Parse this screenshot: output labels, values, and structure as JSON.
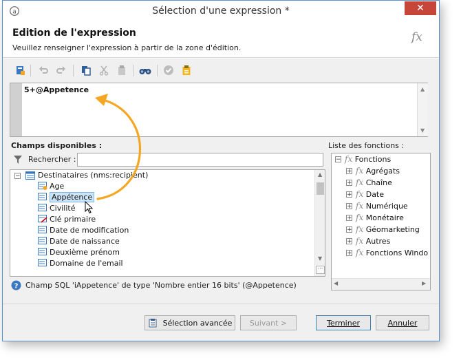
{
  "window": {
    "title": "Sélection d'une expression *",
    "close_glyph": "✕"
  },
  "header": {
    "title": "Edition de l'expression",
    "subtitle": "Veuillez renseigner l'expression à partir de la zone d'édition."
  },
  "editor": {
    "expression": "5+@Appetence"
  },
  "fields_panel": {
    "label": "Champs disponibles :",
    "search_label": "Rechercher :",
    "search_value": "",
    "root": "Destinataires (nms:recipient)",
    "items": [
      {
        "label": "Age",
        "icon": "calculated-field-icon",
        "selected": false
      },
      {
        "label": "Appétence",
        "icon": "field-icon",
        "selected": true
      },
      {
        "label": "Civilité",
        "icon": "field-icon",
        "selected": false
      },
      {
        "label": "Clé primaire",
        "icon": "key-field-icon",
        "selected": false
      },
      {
        "label": "Date de modification",
        "icon": "field-icon",
        "selected": false
      },
      {
        "label": "Date de naissance",
        "icon": "field-icon",
        "selected": false
      },
      {
        "label": "Deuxième prénom",
        "icon": "field-icon",
        "selected": false
      },
      {
        "label": "Domaine de l'email",
        "icon": "field-icon",
        "selected": false
      }
    ]
  },
  "functions_panel": {
    "label": "Liste des fonctions :",
    "root": "Fonctions",
    "items": [
      "Agrégats",
      "Chaîne",
      "Date",
      "Numérique",
      "Monétaire",
      "Géomarketing",
      "Autres",
      "Fonctions Windo"
    ]
  },
  "status": {
    "text": "Champ SQL 'iAppetence' de type 'Nombre entier 16 bits' (@Appetence)"
  },
  "buttons": {
    "advanced": "Sélection avancée",
    "next": "Suivant >",
    "finish": "Terminer",
    "cancel": "Annuler"
  },
  "colors": {
    "accent": "#3c7fb1",
    "selection": "#cce4f7",
    "arrow": "#f5a623",
    "close": "#c7463a"
  }
}
